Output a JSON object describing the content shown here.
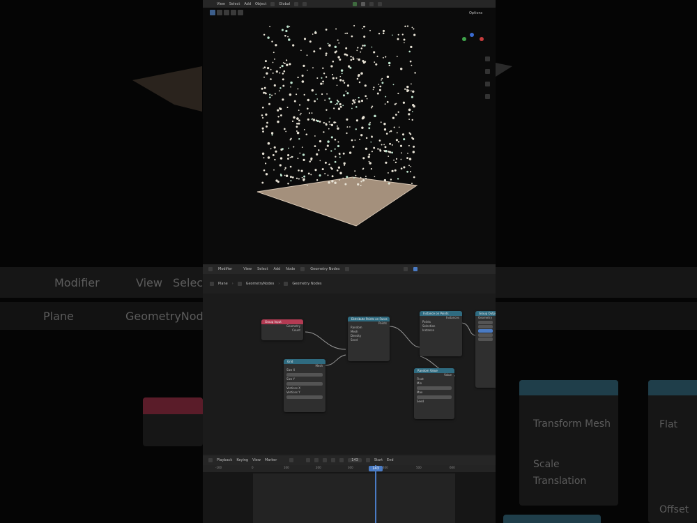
{
  "background": {
    "header_menu": [
      "Modifier",
      "View",
      "Select"
    ],
    "breadcrumb": [
      "Plane",
      "GeometryNodes"
    ],
    "node_labels": [
      "Transform Mesh",
      "Flat",
      "Scale",
      "Translation",
      "Offset"
    ]
  },
  "topbar": {
    "menus": [
      "View",
      "Select",
      "Add",
      "Object"
    ],
    "orientation": "Global",
    "options_label": "Options"
  },
  "node_editor": {
    "header": {
      "editor_type": "Modifier",
      "menus": [
        "View",
        "Select",
        "Add",
        "Node"
      ],
      "tree_name": "Geometry Nodes"
    },
    "breadcrumb": [
      "Plane",
      "GeometryNodes",
      "Geometry Nodes"
    ],
    "nodes": {
      "group_input": {
        "title": "Group Input",
        "rows": [
          "Geometry",
          "Count"
        ]
      },
      "grid": {
        "title": "Grid",
        "rows": [
          "Mesh",
          "Size X",
          "Size Y",
          "Vertices X",
          "Vertices Y"
        ]
      },
      "distribute": {
        "title": "Distribute Points on Faces",
        "rows": [
          "Points",
          "Random",
          "Mesh",
          "Density",
          "Seed"
        ]
      },
      "instance": {
        "title": "Instance on Points",
        "rows": [
          "Instances",
          "Points",
          "Selection",
          "Instance"
        ]
      },
      "random": {
        "title": "Random Value",
        "rows": [
          "Value",
          "Float",
          "Min",
          "Max",
          "Seed"
        ]
      },
      "output": {
        "title": "Group Output",
        "rows": [
          "Geometry"
        ]
      }
    }
  },
  "timeline": {
    "menus": [
      "Playback",
      "Keying",
      "View",
      "Marker"
    ],
    "current_frame": "143",
    "start_label": "Start",
    "end_label": "End",
    "ticks": [
      "-100",
      "0",
      "100",
      "200",
      "300",
      "400",
      "500",
      "600"
    ]
  },
  "colors": {
    "accent": "#4a7bc4",
    "group_input_header": "#b33b53",
    "geometry_node_header": "#2f6b80"
  }
}
